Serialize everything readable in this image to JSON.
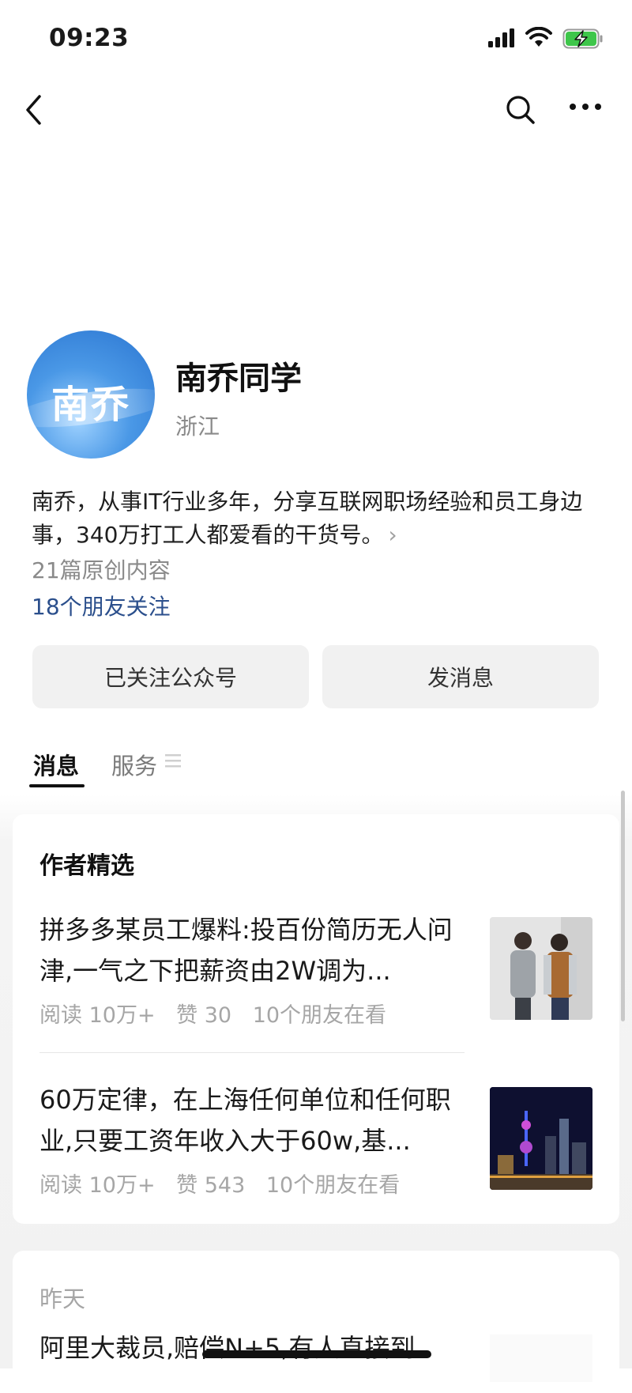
{
  "status_bar": {
    "time": "09:23"
  },
  "profile": {
    "avatar_text": "南乔",
    "name": "南乔同学",
    "region": "浙江",
    "description": "南乔，从事IT行业多年，分享互联网职场经验和员工身边事，340万打工人都爱看的干货号。",
    "original_count": "21篇原创内容",
    "friends_following": "18个朋友关注"
  },
  "actions": {
    "follow": "已关注公众号",
    "message": "发消息"
  },
  "tabs": [
    {
      "label": "消息"
    },
    {
      "label": "服务"
    }
  ],
  "featured": {
    "title": "作者精选",
    "articles": [
      {
        "title": "拼多多某员工爆料:投百份简历无人问津,一气之下把薪资由2W调为...",
        "reads": "阅读 10万+",
        "likes": "赞 30",
        "friends": "10个朋友在看"
      },
      {
        "title": "60万定律，在上海任何单位和任何职业,只要工资年收入大于60w,基...",
        "reads": "阅读 10万+",
        "likes": "赞 543",
        "friends": "10个朋友在看"
      }
    ]
  },
  "feed": {
    "date_label": "昨天",
    "article_title": "阿里大裁员,赔偿N+5,有人直接到"
  }
}
